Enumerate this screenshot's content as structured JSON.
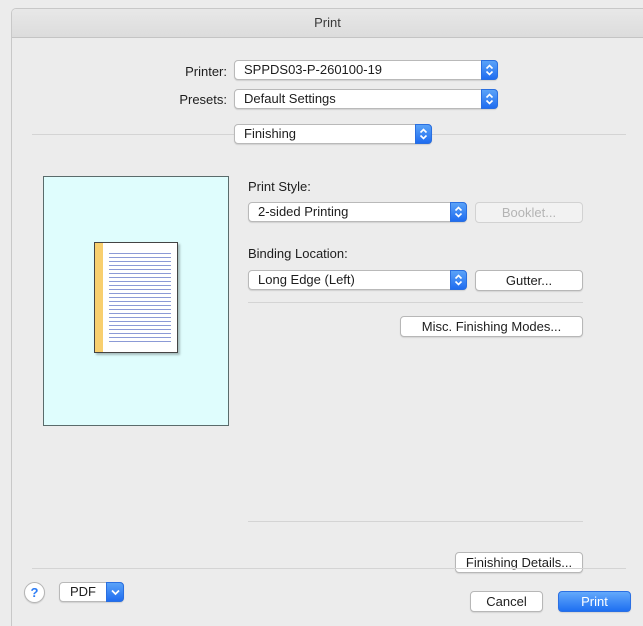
{
  "window": {
    "title": "Print"
  },
  "printer": {
    "label": "Printer:",
    "value": "SPPDS03-P-260100-19"
  },
  "presets": {
    "label": "Presets:",
    "value": "Default Settings"
  },
  "panel": {
    "value": "Finishing"
  },
  "print_style": {
    "label": "Print Style:",
    "value": "2-sided Printing",
    "booklet_label": "Booklet..."
  },
  "binding": {
    "label": "Binding Location:",
    "value": "Long Edge (Left)",
    "gutter_label": "Gutter..."
  },
  "misc_label": "Misc. Finishing Modes...",
  "details_label": "Finishing Details...",
  "footer": {
    "help_label": "?",
    "pdf_label": "PDF",
    "cancel_label": "Cancel",
    "print_label": "Print"
  },
  "preview": {
    "binding_color": "#f8cf6e",
    "background_color": "#dffdfd"
  }
}
